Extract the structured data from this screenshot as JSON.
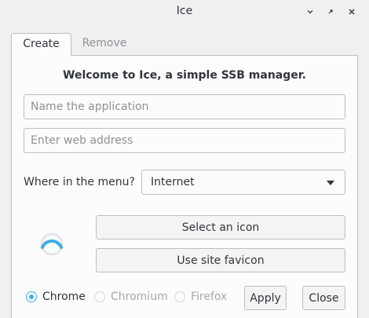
{
  "window": {
    "title": "Ice"
  },
  "tabs": [
    {
      "label": "Create",
      "active": true
    },
    {
      "label": "Remove",
      "active": false
    }
  ],
  "welcome": "Welcome to Ice, a simple SSB manager.",
  "form": {
    "app_name": {
      "value": "",
      "placeholder": "Name the application"
    },
    "web_address": {
      "value": "",
      "placeholder": "Enter web address"
    },
    "menu_label": "Where in the menu?",
    "menu_selected": "Internet"
  },
  "icon_buttons": {
    "select_icon": "Select an icon",
    "use_favicon": "Use site favicon"
  },
  "browsers": [
    {
      "label": "Chrome",
      "checked": true,
      "enabled": true
    },
    {
      "label": "Chromium",
      "checked": false,
      "enabled": false
    },
    {
      "label": "Firefox",
      "checked": false,
      "enabled": false
    }
  ],
  "actions": {
    "apply": "Apply",
    "close": "Close"
  },
  "colors": {
    "accent": "#3daee9",
    "background": "#eff0f1",
    "panel": "#fcfcfc"
  }
}
